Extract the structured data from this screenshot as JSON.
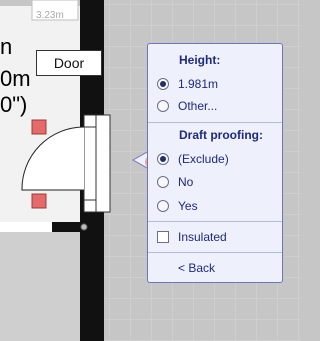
{
  "plan": {
    "scale_label": "3.23m",
    "door_label": "Door",
    "room_lines": [
      "n",
      "0m",
      "0\")"
    ]
  },
  "popup": {
    "height": {
      "title": "Height:",
      "options": [
        {
          "label": "1.981m",
          "selected": true
        },
        {
          "label": "Other...",
          "selected": false
        }
      ]
    },
    "draft": {
      "title": "Draft proofing:",
      "options": [
        {
          "label": "(Exclude)",
          "selected": true
        },
        {
          "label": "No",
          "selected": false
        },
        {
          "label": "Yes",
          "selected": false
        }
      ]
    },
    "insulated": {
      "label": "Insulated",
      "checked": false
    },
    "back_label": "< Back"
  },
  "colors": {
    "wall": "#111111",
    "floor": "#f2f2f2",
    "grid": "#d0d0d0",
    "handle": "#e36b6b",
    "popup_border": "#6f76b8",
    "accent": "#1f2a7a"
  }
}
